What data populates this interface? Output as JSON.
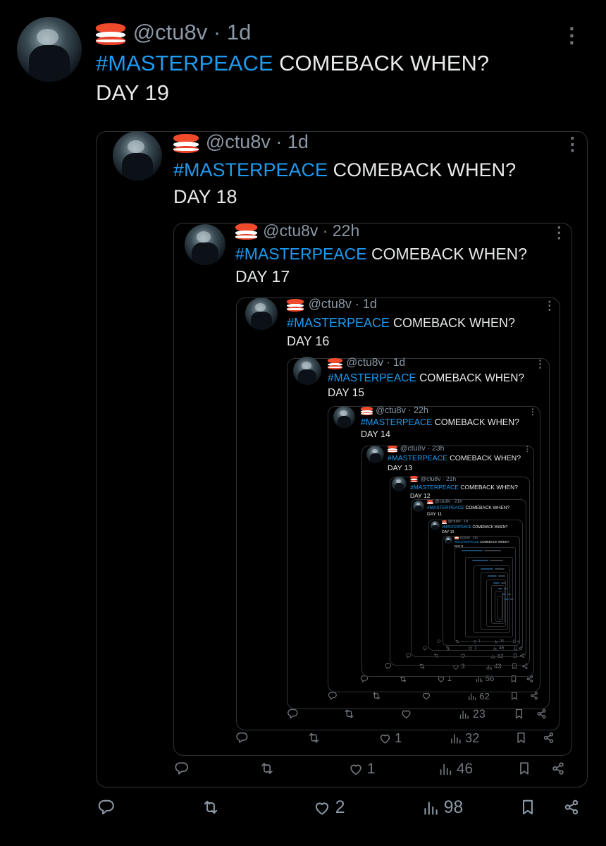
{
  "colors": {
    "background": "#000000",
    "text": "#e7e9ea",
    "secondary": "#71767b",
    "accent": "#1d9bf0",
    "border": "#2f3336"
  },
  "author": {
    "handle": "@ctu8v",
    "emoji": "sushi-icon"
  },
  "icons": {
    "reply": "reply-icon",
    "retweet": "retweet-icon",
    "like": "heart-icon",
    "views": "views-icon",
    "bookmark": "bookmark-icon",
    "share": "share-icon",
    "more": "more-dots-icon"
  },
  "posts": [
    {
      "handle": "@ctu8v",
      "time": "1d",
      "hashtag": "#MASTERPEACE",
      "text": " COMEBACK WHEN?",
      "day": "DAY 19",
      "likes": "2",
      "views": "98"
    },
    {
      "handle": "@ctu8v",
      "time": "1d",
      "hashtag": "#MASTERPEACE",
      "text": " COMEBACK WHEN?",
      "day": "DAY 18",
      "likes": "1",
      "views": "46"
    },
    {
      "handle": "@ctu8v",
      "time": "22h",
      "hashtag": "#MASTERPEACE",
      "text": " COMEBACK WHEN?",
      "day": "DAY 17",
      "likes": "1",
      "views": "32"
    },
    {
      "handle": "@ctu8v",
      "time": "1d",
      "hashtag": "#MASTERPEACE",
      "text": " COMEBACK WHEN?",
      "day": "DAY 16",
      "likes": "",
      "views": "23"
    },
    {
      "handle": "@ctu8v",
      "time": "1d",
      "hashtag": "#MASTERPEACE",
      "text": " COMEBACK WHEN?",
      "day": "DAY 15",
      "likes": "",
      "views": "62"
    },
    {
      "handle": "@ctu8v",
      "time": "22h",
      "hashtag": "#MASTERPEACE",
      "text": " COMEBACK WHEN?",
      "day": "DAY 14",
      "likes": "1",
      "views": "56"
    },
    {
      "handle": "@ctu8v",
      "time": "23h",
      "hashtag": "#MASTERPEACE",
      "text": " COMEBACK WHEN?",
      "day": "DAY 13",
      "likes": "3",
      "views": "43"
    },
    {
      "handle": "@ctu8v",
      "time": "21h",
      "hashtag": "#MASTERPEACE",
      "text": " COMEBACK WHEN?",
      "day": "DAY 12",
      "likes": "",
      "views": "52"
    },
    {
      "handle": "@ctu8v",
      "time": "21h",
      "hashtag": "#MASTERPEACE",
      "text": " COMEBACK WHEN?",
      "day": "DAY 11",
      "likes": "1",
      "views": "46"
    },
    {
      "handle": "@ctu8v",
      "time": "1d",
      "hashtag": "#MASTERPEACE",
      "text": " COMEBACK WHEN?",
      "day": "DAY 10",
      "likes": "1",
      "views": "25"
    },
    {
      "handle": "@ctu8v",
      "time": "21h",
      "hashtag": "#MASTERPEACE",
      "text": " COMEBACK WHEN?",
      "day": "DAY 9",
      "likes": "",
      "views": ""
    }
  ]
}
